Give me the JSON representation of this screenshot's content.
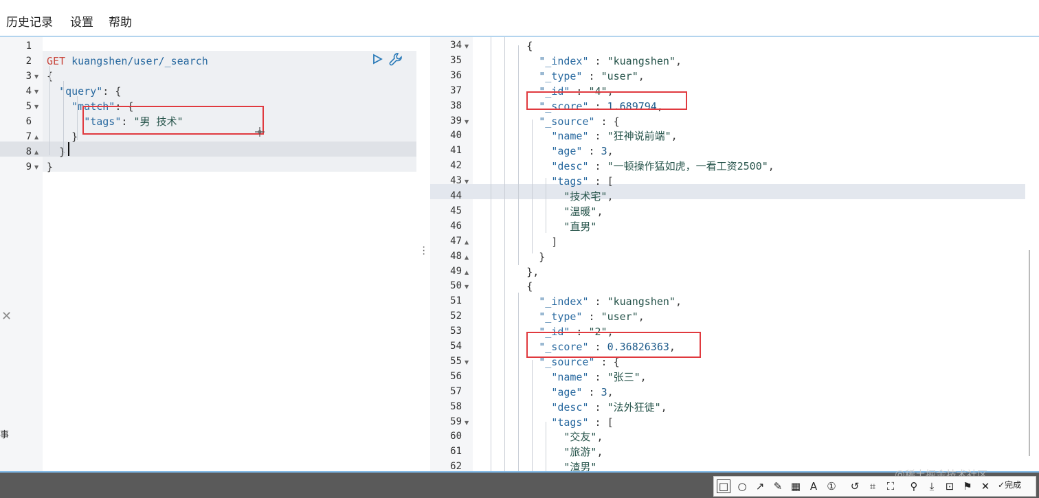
{
  "menu": [
    "历史记录",
    "设置",
    "帮助"
  ],
  "left_editor": {
    "lines": [
      {
        "n": "1",
        "fold": "",
        "html": ""
      },
      {
        "n": "2",
        "fold": "",
        "html": "<span class='m'>GET</span> <span class='k'>kuangshen/user/_search</span>"
      },
      {
        "n": "3",
        "fold": "▼",
        "html": "<span class='p'>{</span>"
      },
      {
        "n": "4",
        "fold": "▼",
        "html": "  <span class='k'>\"query\"</span><span class='p'>: {</span>"
      },
      {
        "n": "5",
        "fold": "▼",
        "html": "    <span class='k'>\"match\"</span><span class='p'>: {</span>"
      },
      {
        "n": "6",
        "fold": "",
        "html": "      <span class='k'>\"tags\"</span><span class='p'>: </span><span class='s'>\"男 技术\"</span>"
      },
      {
        "n": "7",
        "fold": "▲",
        "html": "    <span class='p'>}</span>"
      },
      {
        "n": "8",
        "fold": "▲",
        "html": "  <span class='p'>}</span>"
      },
      {
        "n": "9",
        "fold": "▼",
        "html": "<span class='p'>}</span>"
      }
    ]
  },
  "right_editor": {
    "lines": [
      {
        "n": "34",
        "fold": "▼",
        "html": "      <span class='p'>{</span>"
      },
      {
        "n": "35",
        "fold": "",
        "html": "        <span class='k'>\"_index\"</span><span class='p'> : </span><span class='s'>\"kuangshen\"</span><span class='p'>,</span>"
      },
      {
        "n": "36",
        "fold": "",
        "html": "        <span class='k'>\"_type\"</span><span class='p'> : </span><span class='s'>\"user\"</span><span class='p'>,</span>"
      },
      {
        "n": "37",
        "fold": "",
        "html": "        <span class='k'>\"_id\"</span><span class='p'> : </span><span class='s'>\"4\"</span><span class='p'>,</span>"
      },
      {
        "n": "38",
        "fold": "",
        "html": "        <span class='k'>\"_score\"</span><span class='p'> : </span><span class='num'>1.689794</span><span class='p'>,</span>"
      },
      {
        "n": "39",
        "fold": "▼",
        "html": "        <span class='k'>\"_source\"</span><span class='p'> : {</span>"
      },
      {
        "n": "40",
        "fold": "",
        "html": "          <span class='k'>\"name\"</span><span class='p'> : </span><span class='s'>\"狂神说前端\"</span><span class='p'>,</span>"
      },
      {
        "n": "41",
        "fold": "",
        "html": "          <span class='k'>\"age\"</span><span class='p'> : </span><span class='num'>3</span><span class='p'>,</span>"
      },
      {
        "n": "42",
        "fold": "",
        "html": "          <span class='k'>\"desc\"</span><span class='p'> : </span><span class='s'>\"一顿操作猛如虎，一看工资2500\"</span><span class='p'>,</span>"
      },
      {
        "n": "43",
        "fold": "▼",
        "html": "          <span class='k'>\"tags\"</span><span class='p'> : [</span>"
      },
      {
        "n": "44",
        "fold": "",
        "html": "            <span class='s'>\"技术宅\"</span><span class='p'>,</span>"
      },
      {
        "n": "45",
        "fold": "",
        "html": "            <span class='s'>\"温暖\"</span><span class='p'>,</span>"
      },
      {
        "n": "46",
        "fold": "",
        "html": "            <span class='s'>\"直男\"</span>"
      },
      {
        "n": "47",
        "fold": "▲",
        "html": "          <span class='p'>]</span>"
      },
      {
        "n": "48",
        "fold": "▲",
        "html": "        <span class='p'>}</span>"
      },
      {
        "n": "49",
        "fold": "▲",
        "html": "      <span class='p'>},</span>"
      },
      {
        "n": "50",
        "fold": "▼",
        "html": "      <span class='p'>{</span>"
      },
      {
        "n": "51",
        "fold": "",
        "html": "        <span class='k'>\"_index\"</span><span class='p'> : </span><span class='s'>\"kuangshen\"</span><span class='p'>,</span>"
      },
      {
        "n": "52",
        "fold": "",
        "html": "        <span class='k'>\"_type\"</span><span class='p'> : </span><span class='s'>\"user\"</span><span class='p'>,</span>"
      },
      {
        "n": "53",
        "fold": "",
        "html": "        <span class='k'>\"_id\"</span><span class='p'> : </span><span class='s'>\"2\"</span><span class='p'>,</span>"
      },
      {
        "n": "54",
        "fold": "",
        "html": "        <span class='k'>\"_score\"</span><span class='p'> : </span><span class='num'>0.36826363</span><span class='p'>,</span>"
      },
      {
        "n": "55",
        "fold": "▼",
        "html": "        <span class='k'>\"_source\"</span><span class='p'> : {</span>"
      },
      {
        "n": "56",
        "fold": "",
        "html": "          <span class='k'>\"name\"</span><span class='p'> : </span><span class='s'>\"张三\"</span><span class='p'>,</span>"
      },
      {
        "n": "57",
        "fold": "",
        "html": "          <span class='k'>\"age\"</span><span class='p'> : </span><span class='num'>3</span><span class='p'>,</span>"
      },
      {
        "n": "58",
        "fold": "",
        "html": "          <span class='k'>\"desc\"</span><span class='p'> : </span><span class='s'>\"法外狂徒\"</span><span class='p'>,</span>"
      },
      {
        "n": "59",
        "fold": "▼",
        "html": "          <span class='k'>\"tags\"</span><span class='p'> : [</span>"
      },
      {
        "n": "60",
        "fold": "",
        "html": "            <span class='s'>\"交友\"</span><span class='p'>,</span>"
      },
      {
        "n": "61",
        "fold": "",
        "html": "            <span class='s'>\"旅游\"</span><span class='p'>,</span>"
      },
      {
        "n": "62",
        "fold": "",
        "html": "            <span class='s'>\"渣男\"</span>"
      }
    ]
  },
  "toolbar": {
    "done_label": "完成"
  },
  "watermark": "@稀土掘金技术社区",
  "side_char": "事",
  "colors": {
    "highlight_box": "#e0393e",
    "accent": "#7bb6e6"
  }
}
